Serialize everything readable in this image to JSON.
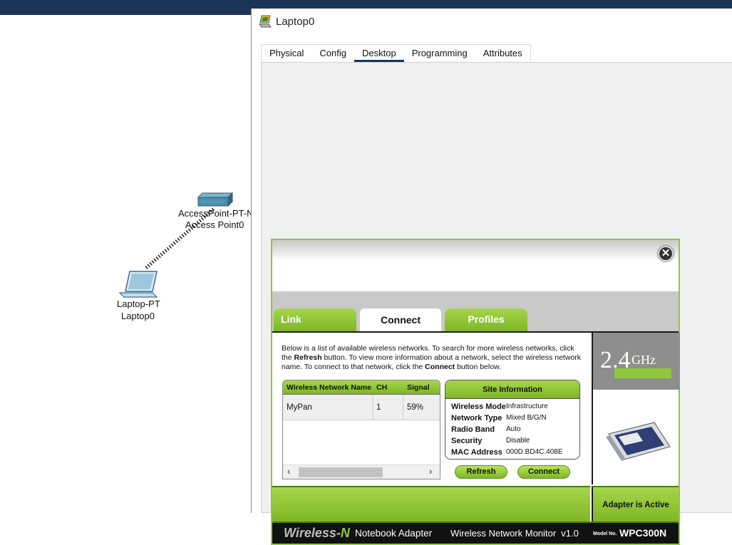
{
  "window": {
    "title": "Laptop0",
    "tabs": [
      "Physical",
      "Config",
      "Desktop",
      "Programming",
      "Attributes"
    ],
    "active_tab": "Desktop"
  },
  "canvas": {
    "access_point": {
      "model": "AccessPoint-PT-N",
      "name": "Access Point0"
    },
    "laptop": {
      "model": "Laptop-PT",
      "name": "Laptop0"
    }
  },
  "monitor": {
    "close_symbol": "✕",
    "tabs": [
      "Link Information",
      "Connect",
      "Profiles"
    ],
    "active_tab": "Connect",
    "description": {
      "part1": "Below is a list of available wireless networks. To search for more wireless networks, click the ",
      "refresh_word": "Refresh",
      "part2": " button. To view more information about a network, select the wireless network name. To connect to that network, click the ",
      "connect_word": "Connect",
      "part3": " button below."
    },
    "network_table": {
      "headers": [
        "Wireless Network Name",
        "CH",
        "Signal"
      ],
      "rows": [
        {
          "name": "MyPan",
          "ch": "1",
          "signal": "59%"
        }
      ]
    },
    "site_info": {
      "title": "Site Information",
      "rows": [
        {
          "key": "Wireless Mode",
          "value": "Infrastructure"
        },
        {
          "key": "Network Type",
          "value": "Mixed B/G/N"
        },
        {
          "key": "Radio Band",
          "value": "Auto"
        },
        {
          "key": "Security",
          "value": "Disable"
        },
        {
          "key": "MAC Address",
          "value": "000D.BD4C.408E"
        }
      ]
    },
    "refresh_button": "Refresh",
    "connect_button": "Connect",
    "ghz_number": "2.4",
    "ghz_unit": "GHz",
    "adapter_status": "Adapter is Active",
    "footer": {
      "brand": "Wireless-",
      "brand_letter": "N",
      "product": "Notebook Adapter",
      "app": "Wireless Network Monitor  v1.0",
      "model_label": "Model No.",
      "model": "WPC300N"
    }
  },
  "colors": {
    "accent_green": "#8fc93a",
    "titlebar": "#1c3457"
  }
}
